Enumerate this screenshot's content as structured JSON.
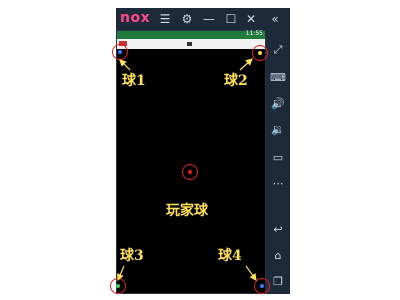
{
  "emulator": {
    "logo": "nox",
    "titlebar_icons": [
      "menu-icon",
      "gear-icon",
      "minimize-icon",
      "maximize-icon",
      "close-icon",
      "collapse-icon"
    ],
    "sidebar_icons": [
      "expand-icon",
      "keyboard-icon",
      "volume-up-icon",
      "volume-down-icon",
      "screen-icon",
      "more-icon",
      "back-icon",
      "home-icon",
      "recent-apps-icon"
    ]
  },
  "status": {
    "time": "11:55"
  },
  "balls": [
    {
      "label": "球1",
      "dot_color": "#3a78ff"
    },
    {
      "label": "球2",
      "dot_color": "#ffd23a"
    },
    {
      "label": "球3",
      "dot_color": "#3ad25a"
    },
    {
      "label": "球4",
      "dot_color": "#3a78ff"
    }
  ],
  "player": {
    "label": "玩家球",
    "dot_color": "#e02020"
  },
  "colors": {
    "annotation": "#ffe15a",
    "circle": "#e02020",
    "frame": "#1c2a3a"
  }
}
